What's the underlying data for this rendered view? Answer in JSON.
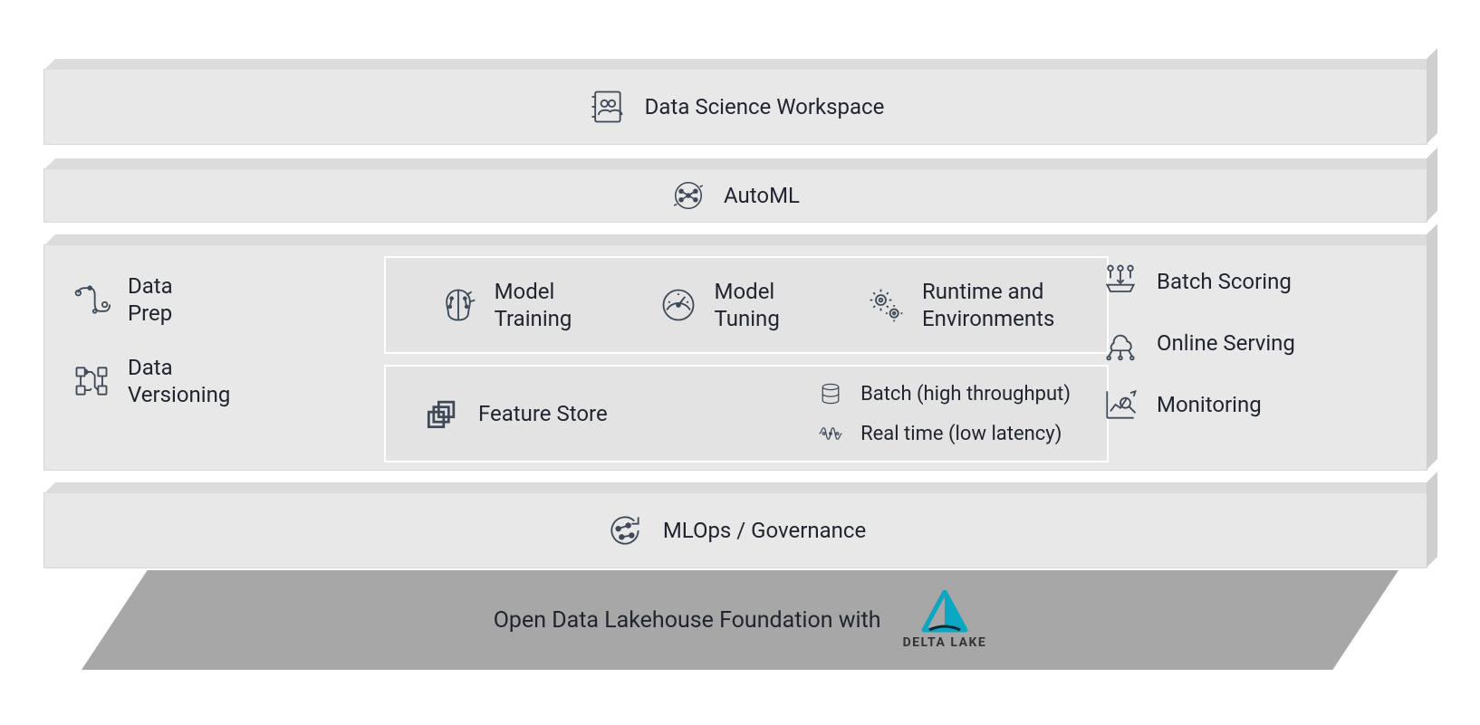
{
  "layers": {
    "workspace": {
      "label": "Data Science Workspace",
      "icon": "contacts-book-icon"
    },
    "automl": {
      "label": "AutoML",
      "icon": "neural-net-icon"
    },
    "data_col": {
      "prep": {
        "label_l1": "Data",
        "label_l2": "Prep",
        "icon": "pipeline-icon"
      },
      "versioning": {
        "label_l1": "Data",
        "label_l2": "Versioning",
        "icon": "branching-icon"
      }
    },
    "model_row": {
      "training": {
        "label_l1": "Model",
        "label_l2": "Training",
        "icon": "brain-icon"
      },
      "tuning": {
        "label_l1": "Model",
        "label_l2": "Tuning",
        "icon": "gauge-icon"
      },
      "runtime": {
        "label_l1": "Runtime and",
        "label_l2": "Environments",
        "icon": "gears-icon"
      }
    },
    "feature_store": {
      "label": "Feature Store",
      "icon": "layers-icon",
      "batch": {
        "label": "Batch (high throughput)",
        "icon": "database-icon"
      },
      "realtime": {
        "label": "Real time (low latency)",
        "icon": "waveform-icon"
      }
    },
    "serving_col": {
      "batch_scoring": {
        "label": "Batch Scoring",
        "icon": "download-tray-icon"
      },
      "online_serving": {
        "label": "Online Serving",
        "icon": "cloud-network-icon"
      },
      "monitoring": {
        "label": "Monitoring",
        "icon": "analytics-icon"
      }
    },
    "mlops": {
      "label": "MLOps / Governance",
      "icon": "refresh-nodes-icon"
    }
  },
  "foundation": {
    "label": "Open Data Lakehouse Foundation with",
    "logo_text": "DELTA LAKE"
  }
}
